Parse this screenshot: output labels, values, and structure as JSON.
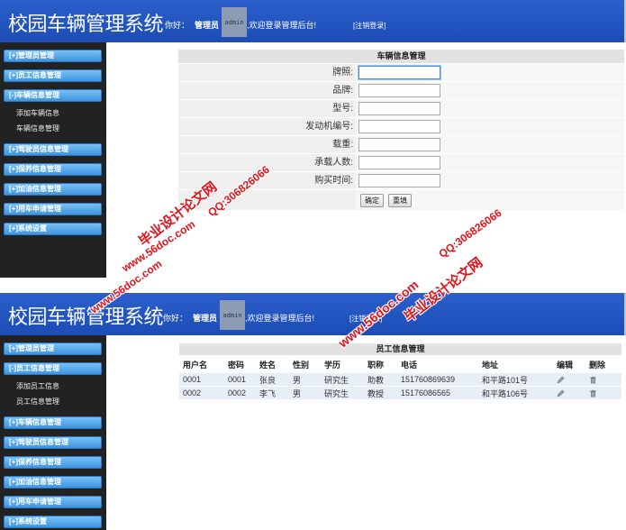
{
  "top": {
    "header": {
      "title": "校园车辆管理系统",
      "greeting": "你好：",
      "role": "管理员",
      "avatar": "admin",
      "welcome": ",欢迎登录管理后台!",
      "logout": "[注销登录]"
    },
    "sidebar": [
      {
        "label": "[+]管理员管理"
      },
      {
        "label": "[+]员工信息管理"
      },
      {
        "label": "[-]车辆信息管理",
        "children": [
          "添加车辆信息",
          "车辆信息管理"
        ]
      },
      {
        "label": "[+]驾驶员信息管理"
      },
      {
        "label": "[+]保养信息管理"
      },
      {
        "label": "[+]加油信息管理"
      },
      {
        "label": "[+]用车申请管理"
      },
      {
        "label": "[+]系统设置"
      }
    ],
    "form": {
      "title": "车辆信息管理",
      "fields": [
        {
          "label": "牌照:"
        },
        {
          "label": "品牌:"
        },
        {
          "label": "型号:"
        },
        {
          "label": "发动机编号:"
        },
        {
          "label": "载重:"
        },
        {
          "label": "承载人数:"
        },
        {
          "label": "购买时间:"
        }
      ],
      "submit": "确定",
      "reset": "重填"
    }
  },
  "bottom": {
    "header": {
      "title": "校园车辆管理系统",
      "greeting": "你好：",
      "role": "管理员",
      "avatar": "admin",
      "welcome": ",欢迎登录管理后台!",
      "logout": "[注销登录]"
    },
    "sidebar": [
      {
        "label": "[+]管理员管理"
      },
      {
        "label": "[-]员工信息管理",
        "children": [
          "添加员工信息",
          "员工信息管理"
        ]
      },
      {
        "label": "[+]车辆信息管理"
      },
      {
        "label": "[+]驾驶员信息管理"
      },
      {
        "label": "[+]保养信息管理"
      },
      {
        "label": "[+]加油信息管理"
      },
      {
        "label": "[+]用车申请管理"
      },
      {
        "label": "[+]系统设置"
      }
    ],
    "table": {
      "title": "员工信息管理",
      "columns": [
        "用户名",
        "密码",
        "姓名",
        "性别",
        "学历",
        "职称",
        "电话",
        "地址",
        "编辑",
        "删除"
      ],
      "rows": [
        [
          "0001",
          "0001",
          "张良",
          "男",
          "研究生",
          "助教",
          "151760869639",
          "和平路101号"
        ],
        [
          "0002",
          "0002",
          "李飞",
          "男",
          "研究生",
          "教授",
          "15176086565",
          "和平路106号"
        ]
      ],
      "edit_icon": "edit-icon",
      "delete_icon": "trash-icon"
    }
  },
  "watermark": {
    "site": "毕业设计论文网",
    "url": "www.56doc.com",
    "qq": "QQ:306826066",
    "color": "#e3131c"
  },
  "colors": {
    "header": "#1c4db6",
    "sidebar": "#222222",
    "menu_button": "#3f94df"
  }
}
